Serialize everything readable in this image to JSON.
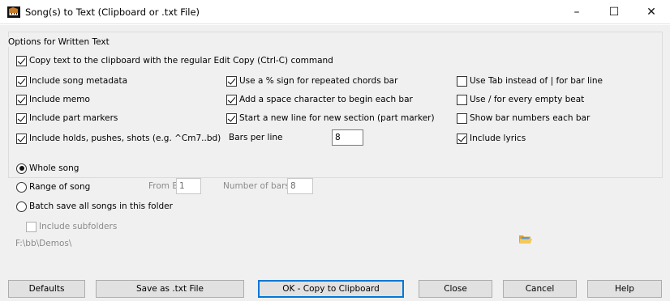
{
  "window": {
    "title": "Song(s) to Text (Clipboard or .txt File)",
    "controls": {
      "minimize": "–",
      "maximize": "☐",
      "close": "✕"
    }
  },
  "options": {
    "group_label": "Options for Written Text",
    "copy_to_clipboard": {
      "label": "Copy text to the clipboard with the regular Edit Copy (Ctrl-C) command",
      "checked": true
    },
    "col1": [
      {
        "label": "Include song metadata",
        "checked": true
      },
      {
        "label": "Include memo",
        "checked": true
      },
      {
        "label": "Include part markers",
        "checked": true
      },
      {
        "label": "Include holds, pushes, shots (e.g. ^Cm7..bd)",
        "checked": true
      }
    ],
    "col2": [
      {
        "label": "Use a % sign for repeated chords bar",
        "checked": true
      },
      {
        "label": "Add a space character to begin each bar",
        "checked": true
      },
      {
        "label": "Start a new line for new section (part marker)",
        "checked": true
      }
    ],
    "bars_per_line": {
      "label": "Bars per line",
      "value": "8"
    },
    "col3": [
      {
        "label": "Use Tab instead of | for bar line",
        "checked": false
      },
      {
        "label": "Use / for every empty beat",
        "checked": false
      },
      {
        "label": "Show bar numbers each bar",
        "checked": false
      },
      {
        "label": "Include lyrics",
        "checked": true
      }
    ]
  },
  "scope": {
    "whole_song": {
      "label": "Whole song",
      "selected": true
    },
    "range_of_song": {
      "label": "Range of song",
      "selected": false
    },
    "from_bar": {
      "label": "From Bar",
      "value": "1"
    },
    "number_of_bars": {
      "label": "Number of bars",
      "value": "8"
    },
    "batch_save": {
      "label": "Batch save all songs in this folder",
      "selected": false
    },
    "include_subfolders": {
      "label": "Include subfolders",
      "checked": false
    },
    "folder_path": "F:\\bb\\Demos\\"
  },
  "buttons": {
    "defaults": "Defaults",
    "save_txt": "Save as .txt File",
    "ok_copy": "OK - Copy to Clipboard",
    "close": "Close",
    "cancel": "Cancel",
    "help": "Help"
  },
  "icons": {
    "app": "band-in-a-box-piano-icon",
    "folder": "open-folder-icon"
  }
}
